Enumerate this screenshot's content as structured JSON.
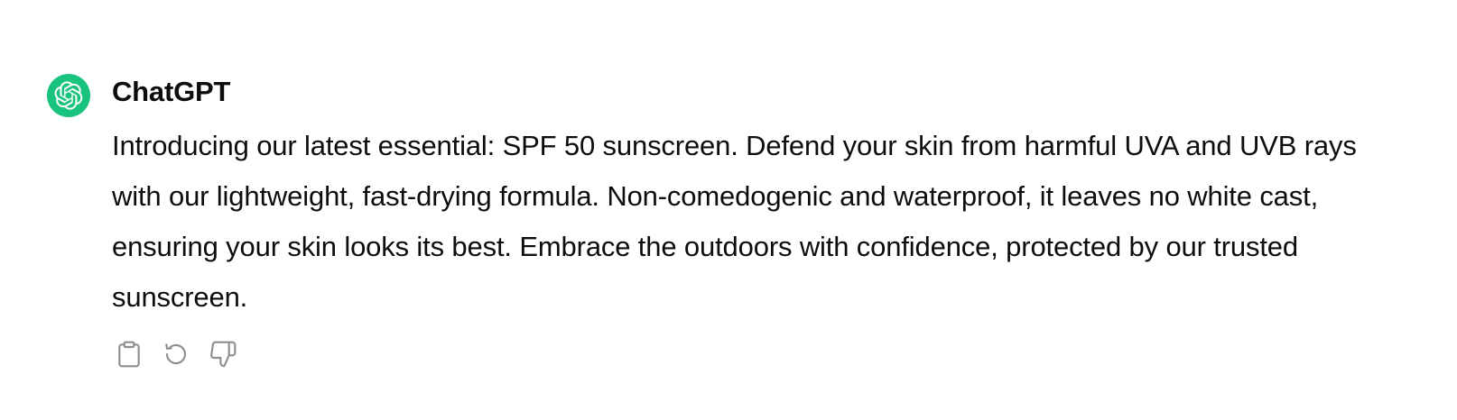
{
  "message": {
    "author": "ChatGPT",
    "avatar_icon": "openai-logo-icon",
    "avatar_color": "#19c37d",
    "text": "Introducing our latest essential: SPF 50 sunscreen. Defend your skin from harmful UVA and UVB rays with our lightweight, fast-drying formula. Non-comedogenic and waterproof, it leaves no white cast, ensuring your skin looks its best. Embrace the outdoors with confidence, protected by our trusted sunscreen."
  },
  "actions": [
    {
      "name": "copy",
      "icon": "clipboard-icon"
    },
    {
      "name": "regenerate",
      "icon": "regenerate-icon"
    },
    {
      "name": "thumbs-down",
      "icon": "thumbs-down-icon"
    }
  ]
}
